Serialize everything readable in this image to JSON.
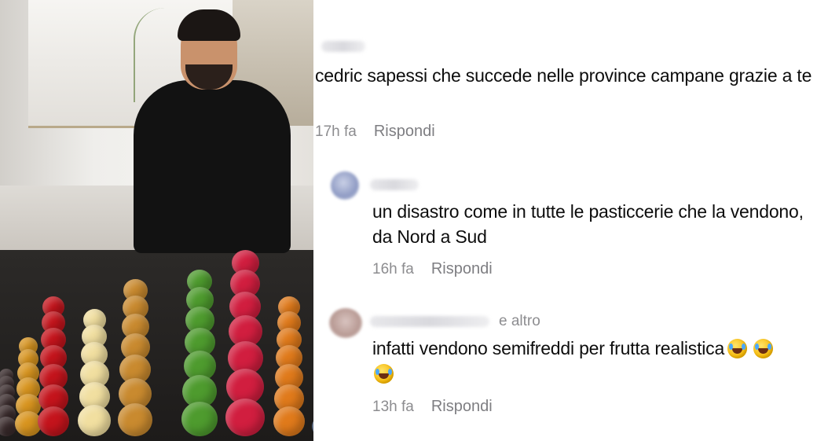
{
  "photo": {
    "description_icon": "pastry-photo"
  },
  "comments": [
    {
      "text": "cedric sapessi che succede nelle province campane grazie a te",
      "time": "17h fa",
      "reply_label": "Rispondi"
    },
    {
      "text": "un disastro come in tutte le pasticcerie che la vendono, da Nord a Sud",
      "time": "16h fa",
      "reply_label": "Rispondi"
    },
    {
      "extra": "e altro",
      "text": "infatti vendono semifreddi per frutta realistica",
      "time": "13h fa",
      "reply_label": "Rispondi"
    }
  ],
  "colors": {
    "meta_gray": "#8c8c8f",
    "text": "#0d0d0d"
  }
}
